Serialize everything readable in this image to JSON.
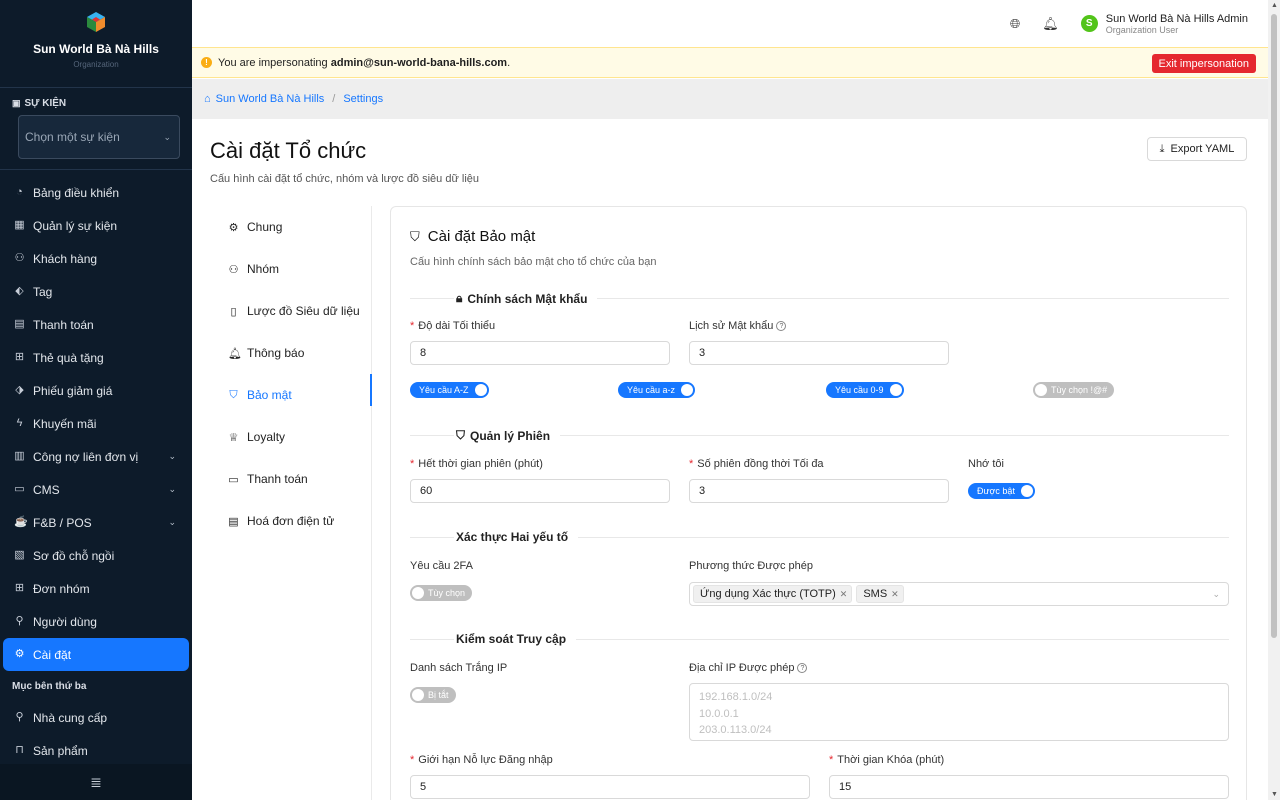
{
  "sidebar": {
    "brand_name": "Sun World Bà Nà Hills",
    "brand_sub": "Organization",
    "event_label": "SỰ KIỆN",
    "event_placeholder": "Chọn một sự kiện",
    "items": [
      {
        "label": "Bảng điều khiển",
        "icon": "dashboard-icon"
      },
      {
        "label": "Quản lý sự kiện",
        "icon": "calendar-icon"
      },
      {
        "label": "Khách hàng",
        "icon": "users-icon"
      },
      {
        "label": "Tag",
        "icon": "tag-icon"
      },
      {
        "label": "Thanh toán",
        "icon": "payment-icon"
      },
      {
        "label": "Thẻ quà tặng",
        "icon": "gift-icon"
      },
      {
        "label": "Phiếu giảm giá",
        "icon": "coupon-icon"
      },
      {
        "label": "Khuyến mãi",
        "icon": "lightning-icon"
      },
      {
        "label": "Công nợ liên đơn vị",
        "icon": "ledger-icon"
      },
      {
        "label": "CMS",
        "icon": "cms-icon"
      },
      {
        "label": "F&B / POS",
        "icon": "fnb-icon"
      },
      {
        "label": "Sơ đồ chỗ ngồi",
        "icon": "seatmap-icon"
      },
      {
        "label": "Đơn nhóm",
        "icon": "group-order-icon"
      },
      {
        "label": "Người dùng",
        "icon": "user-icon"
      },
      {
        "label": "Cài đặt",
        "icon": "gear-icon"
      }
    ],
    "section_third_party": "Mục bên thứ ba",
    "third_party_items": [
      {
        "label": "Nhà cung cấp",
        "icon": "supplier-icon"
      },
      {
        "label": "Sản phẩm",
        "icon": "product-icon"
      }
    ]
  },
  "header": {
    "user_initial": "S",
    "user_name": "Sun World Bà Nà Hills Admin",
    "user_role": "Organization User"
  },
  "impersonation": {
    "prefix": "You are impersonating",
    "email": "admin@sun-world-bana-hills.com",
    "suffix": ".",
    "exit_label": "Exit impersonation"
  },
  "breadcrumb": {
    "home": "Sun World Bà Nà Hills",
    "separator": "/",
    "current": "Settings"
  },
  "page": {
    "title": "Cài đặt Tổ chức",
    "subtitle": "Cấu hình cài đặt tổ chức, nhóm và lược đồ siêu dữ liệu",
    "export_label": "Export YAML"
  },
  "settings_menu": [
    {
      "label": "Chung",
      "icon": "gear-icon"
    },
    {
      "label": "Nhóm",
      "icon": "team-icon"
    },
    {
      "label": "Lược đồ Siêu dữ liệu",
      "icon": "schema-icon"
    },
    {
      "label": "Thông báo",
      "icon": "bell-icon"
    },
    {
      "label": "Bảo mật",
      "icon": "shield-icon"
    },
    {
      "label": "Loyalty",
      "icon": "trophy-icon"
    },
    {
      "label": "Thanh toán",
      "icon": "card-icon"
    },
    {
      "label": "Hoá đơn điện tử",
      "icon": "invoice-icon"
    }
  ],
  "security": {
    "title": "Cài đặt Bảo mật",
    "subtitle": "Cấu hình chính sách bảo mật cho tổ chức của bạn",
    "password": {
      "section": "Chính sách Mật khẩu",
      "min_length_label": "Độ dài Tối thiểu",
      "min_length_value": "8",
      "history_label": "Lịch sử Mật khẩu",
      "history_value": "3",
      "toggles": [
        {
          "label": "Yêu cầu A-Z",
          "on": true
        },
        {
          "label": "Yêu cầu a-z",
          "on": true
        },
        {
          "label": "Yêu cầu 0-9",
          "on": true
        },
        {
          "label": "Tùy chọn !@#",
          "on": false
        }
      ]
    },
    "session": {
      "section": "Quản lý Phiên",
      "timeout_label": "Hết thời gian phiên (phút)",
      "timeout_value": "60",
      "max_sessions_label": "Số phiên đồng thời Tối đa",
      "max_sessions_value": "3",
      "remember_label": "Nhớ tôi",
      "remember_toggle": "Được bật"
    },
    "two_factor": {
      "section": "Xác thực Hai yếu tố",
      "require_label": "Yêu cầu 2FA",
      "require_toggle": "Tùy chọn",
      "methods_label": "Phương thức Được phép",
      "methods": [
        "Ứng dụng Xác thực (TOTP)",
        "SMS"
      ]
    },
    "access": {
      "section": "Kiểm soát Truy cập",
      "whitelist_label": "Danh sách Trắng IP",
      "whitelist_toggle": "Bị tắt",
      "allowed_ips_label": "Địa chỉ IP Được phép",
      "allowed_ips_placeholder": [
        "192.168.1.0/24",
        "10.0.0.1",
        "203.0.113.0/24"
      ],
      "login_limit_label": "Giới hạn Nỗ lực Đăng nhập",
      "login_limit_value": "5",
      "lock_time_label": "Thời gian Khóa (phút)",
      "lock_time_value": "15"
    }
  },
  "colors": {
    "sidebar_bg": "#0d1b2a",
    "accent": "#1677ff",
    "danger": "#e5282f",
    "warning_bg": "#fffbe6"
  }
}
